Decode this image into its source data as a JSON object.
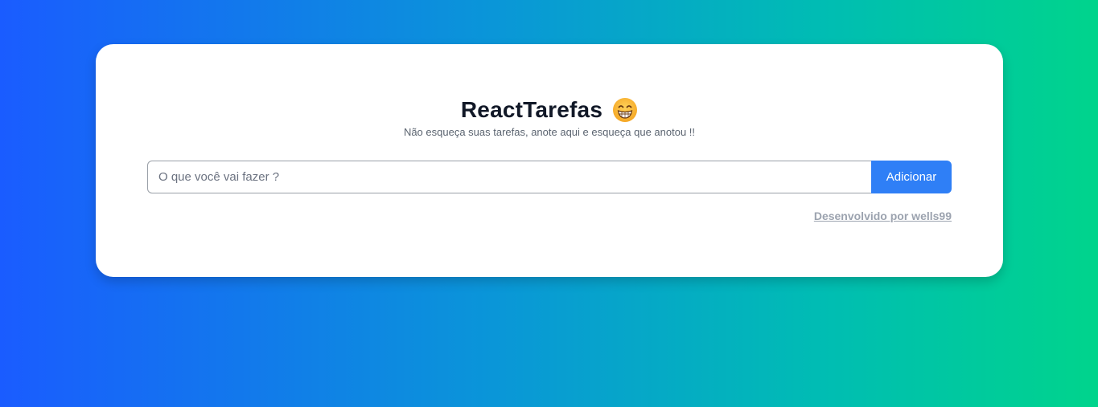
{
  "header": {
    "title": "ReactTarefas",
    "emoji_icon": "grinning-face-with-smiling-eyes-icon",
    "subtitle": "Não esqueça suas tarefas, anote aqui e esqueça que anotou !!"
  },
  "task_form": {
    "input_value": "",
    "input_placeholder": "O que você vai fazer ?",
    "add_button_label": "Adicionar"
  },
  "footer": {
    "credit_label": "Desenvolvido por wells99"
  },
  "colors": {
    "gradient_start": "#1a5cff",
    "gradient_end": "#00d48c",
    "card_background": "#ffffff",
    "button_background": "#2f7ff6",
    "title_color": "#111827",
    "credit_color": "#9ca3af"
  }
}
